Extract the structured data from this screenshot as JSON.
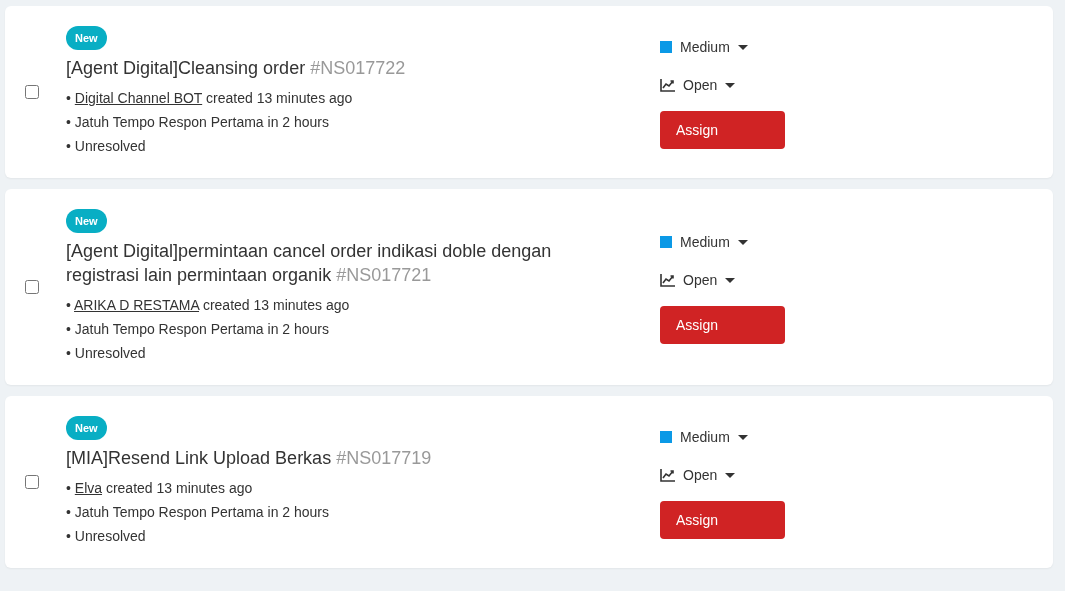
{
  "tickets": [
    {
      "checked": false,
      "badge": "New",
      "title": "[Agent Digital]Cleansing order",
      "number": "#NS017722",
      "lines": [
        {
          "kind": "author",
          "bullet": "•",
          "link": "Digital Channel BOT",
          "text": "created 13 minutes ago"
        },
        {
          "kind": "plain",
          "bullet": "•",
          "text": "Jatuh Tempo Respon Pertama in 2 hours"
        },
        {
          "kind": "plain",
          "bullet": "•",
          "text": "Unresolved"
        }
      ],
      "priority": {
        "label": "Medium",
        "color": "#0b99e6"
      },
      "status": "Open",
      "action": "Assign"
    },
    {
      "checked": false,
      "badge": "New",
      "title": "[Agent Digital]permintaan cancel order indikasi doble dengan registrasi lain permintaan organik",
      "number": "#NS017721",
      "lines": [
        {
          "kind": "author",
          "bullet": "•",
          "link": "ARIKA D RESTAMA",
          "text": "created 13 minutes ago"
        },
        {
          "kind": "plain",
          "bullet": "•",
          "text": "Jatuh Tempo Respon Pertama in 2 hours"
        },
        {
          "kind": "plain",
          "bullet": "•",
          "text": "Unresolved"
        }
      ],
      "priority": {
        "label": "Medium",
        "color": "#0b99e6"
      },
      "status": "Open",
      "action": "Assign"
    },
    {
      "checked": false,
      "badge": "New",
      "title": "[MIA]Resend Link Upload Berkas",
      "number": "#NS017719",
      "lines": [
        {
          "kind": "author",
          "bullet": "•",
          "link": "Elva",
          "text": "created 13 minutes ago"
        },
        {
          "kind": "plain",
          "bullet": "•",
          "text": "Jatuh Tempo Respon Pertama in 2 hours"
        },
        {
          "kind": "plain",
          "bullet": "•",
          "text": "Unresolved"
        }
      ],
      "priority": {
        "label": "Medium",
        "color": "#0b99e6"
      },
      "status": "Open",
      "action": "Assign"
    }
  ]
}
